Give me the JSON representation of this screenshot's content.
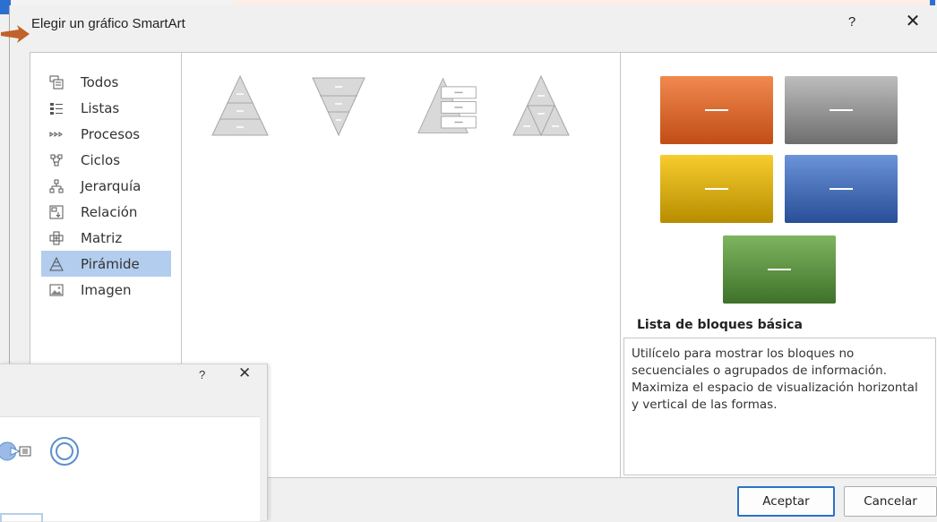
{
  "dialog": {
    "title": "Elegir un gráfico SmartArt",
    "help_label": "?",
    "close_label": "✕"
  },
  "categories": [
    {
      "label": "Todos",
      "icon": "all-icon"
    },
    {
      "label": "Listas",
      "icon": "list-icon"
    },
    {
      "label": "Procesos",
      "icon": "process-icon"
    },
    {
      "label": "Ciclos",
      "icon": "cycle-icon"
    },
    {
      "label": "Jerarquía",
      "icon": "hierarchy-icon"
    },
    {
      "label": "Relación",
      "icon": "relationship-icon"
    },
    {
      "label": "Matriz",
      "icon": "matrix-icon"
    },
    {
      "label": "Pirámide",
      "icon": "pyramid-icon",
      "selected": true
    },
    {
      "label": "Imagen",
      "icon": "picture-icon"
    }
  ],
  "layouts": [
    {
      "icon": "basic-pyramid-icon"
    },
    {
      "icon": "inverted-pyramid-icon"
    },
    {
      "icon": "pyramid-list-icon"
    },
    {
      "icon": "segmented-pyramid-icon"
    }
  ],
  "preview": {
    "tiles": [
      {
        "color": "#d35a1e"
      },
      {
        "color": "#7f7f7f"
      },
      {
        "color": "#d4a500"
      },
      {
        "color": "#3a64b0"
      },
      {
        "color": "#4e8a35"
      }
    ],
    "layout_name": "Lista de bloques básica",
    "description": "Utilícelo para mostrar los bloques no secuenciales o agrupados de información. Maximiza el espacio de visualización horizontal y vertical de las formas."
  },
  "buttons": {
    "ok": "Aceptar",
    "cancel": "Cancelar"
  },
  "background_dialog": {
    "help_label": "?",
    "close_label": "✕"
  },
  "colors": {
    "selection": "#b3cdee",
    "accent": "#2a72c9",
    "arrow": "#c0622a"
  }
}
